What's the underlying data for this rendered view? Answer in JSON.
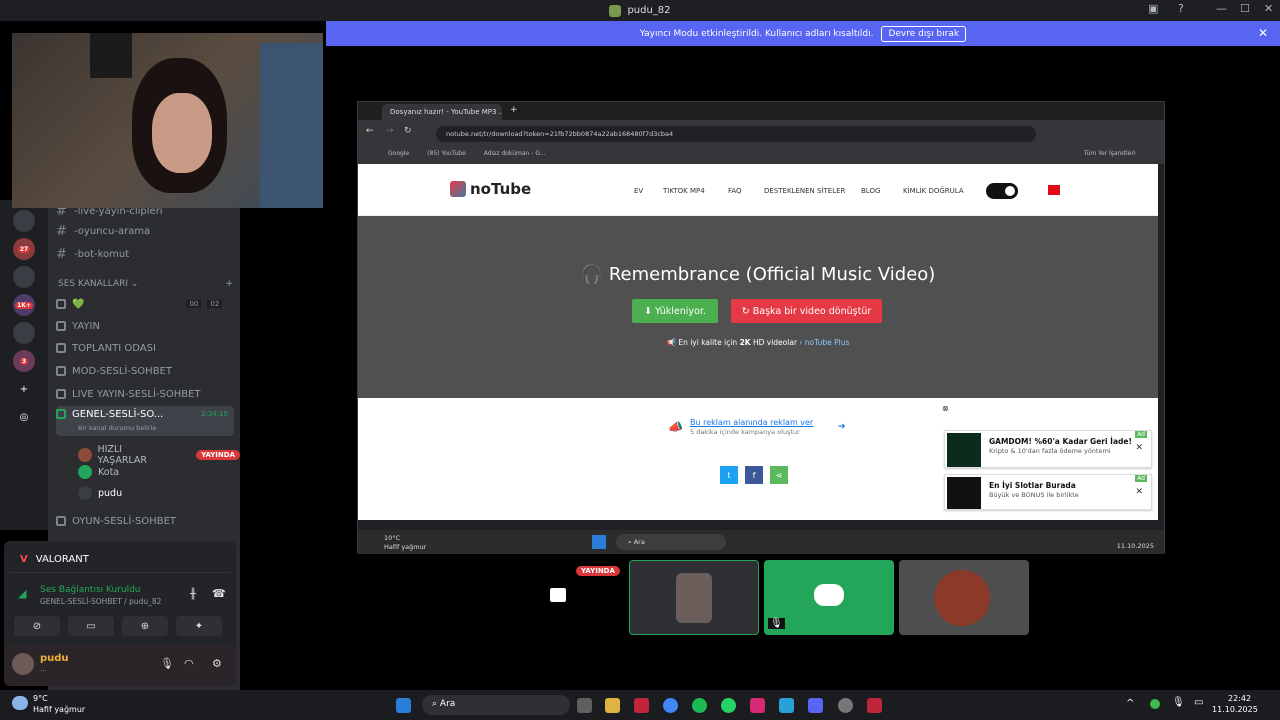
{
  "window": {
    "title": "pudu_82",
    "controls": [
      "▣",
      "?",
      "—",
      "☐",
      "✕"
    ]
  },
  "banner": {
    "text": "Yayıncı Modu etkinleştirildi. Kullanıcı adları kısaltıldı.",
    "button": "Devre dışı bırak",
    "close": "✕"
  },
  "server_rail": {
    "badges": [
      "27",
      "1K+",
      "3"
    ],
    "add_icon": "+",
    "discover_icon": "◎"
  },
  "channels": {
    "text": [
      "-live-yayin-clipleri",
      "-oyuncu-arama",
      "-bot-komut"
    ],
    "voice_category": "SES KANALLARI",
    "voice": [
      {
        "name": "💚",
        "counter_a": "00",
        "counter_b": "02"
      },
      {
        "name": "YAYIN"
      },
      {
        "name": "TOPLANTI ODASI"
      },
      {
        "name": "MOD-SESLİ-SOHBET"
      },
      {
        "name": "LIVE YAYIN-SESLİ-SOHBET"
      },
      {
        "name": "GENEL-SESLİ-SO...",
        "time": "2:34:10",
        "status": "Bir kanal durumu belirle"
      }
    ],
    "members": [
      {
        "name": "HIZLI YAŞARLAR",
        "badge": "YAYINDA"
      },
      {
        "name": "Kota"
      },
      {
        "name": "pudu"
      }
    ],
    "last": "OYUN-SESLİ-SOHBET"
  },
  "voice_panel": {
    "game": "VALORANT",
    "conn_title": "Ses Bağlantısı Kuruldu",
    "conn_sub": "GENEL-SESLİ-SOHBET / pudu_82",
    "user": "pudu",
    "user_sub": "..."
  },
  "browser": {
    "tab_title": "Dosyanız hazır! - YouTube MP3 ...",
    "url": "notube.net/tr/download?token=21fb72bb0874a22ab168480f7d3cba4",
    "bookmarks": [
      "Google",
      "(85) YouTube",
      "Adsız doküman - G...",
      "Tüm Yer İşaretleri"
    ]
  },
  "notube": {
    "logo": "noTube",
    "nav": [
      "EV",
      "TIKTOK MP4",
      "FAQ",
      "DESTEKLENEN SİTELER",
      "BLOG",
      "KİMLİK DOĞRULA"
    ],
    "title": "Remembrance (Official Music Video)",
    "btn_download": "Yükleniyor.",
    "btn_other": "Başka bir video dönüştür",
    "note_pre": "En iyi kalite için ",
    "note_bold": "2K",
    "note_mid": " HD videolar ",
    "note_link": "› noTube Plus",
    "ad_cta": "Bu reklam alanında reklam ver",
    "ad_sub": "5 dakika içinde kampanya oluştur",
    "ads": [
      {
        "title": "GAMDOM! %60'a Kadar Geri İade!",
        "sub": "Kripto & 10'dan fazla ödeme yöntemi",
        "tag": "Ad"
      },
      {
        "title": "En İyi Slotlar Burada",
        "sub": "Büyük ve BONUS ile birlikte",
        "tag": "Ad"
      }
    ]
  },
  "inner_taskbar": {
    "weather": "10°C",
    "weather_sub": "Hafif yağmur",
    "search": "Ara",
    "time": "11.10.2025"
  },
  "tiles": {
    "live_badge": "YAYINDA"
  },
  "os_taskbar": {
    "temp": "9°C",
    "weather": "Hafif yağmur",
    "search": "Ara",
    "time": "22:42",
    "date": "11.10.2025"
  },
  "colors": {
    "discord_bg": "#2b2d31",
    "blurple": "#5865f2",
    "green": "#23a55a",
    "live_red": "#da373c"
  }
}
